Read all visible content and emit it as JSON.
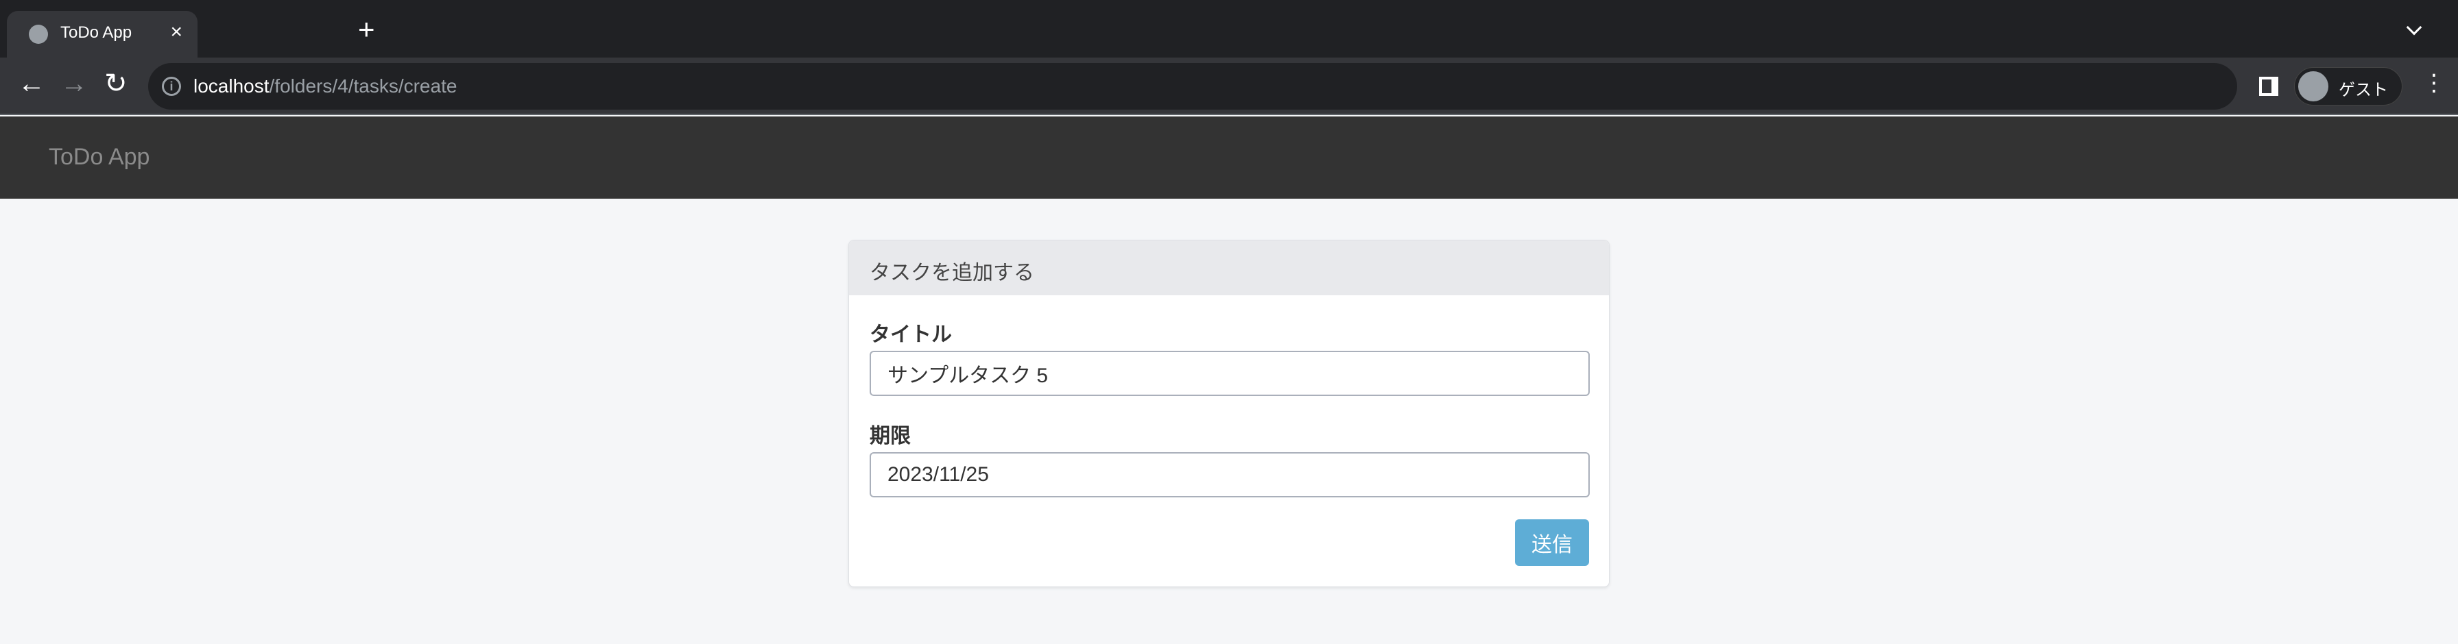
{
  "browser": {
    "tab_title": "ToDo App",
    "url_host": "localhost",
    "url_path": "/folders/4/tasks/create",
    "profile_name": "ゲスト",
    "icons": {
      "back": "←",
      "forward": "→",
      "reload": "↻",
      "new_tab": "+",
      "close": "×",
      "menu": "⋮",
      "info": "i"
    }
  },
  "navbar": {
    "brand": "ToDo App"
  },
  "card": {
    "heading": "タスクを追加する",
    "title_label": "タイトル",
    "title_value": "サンプルタスク 5",
    "due_label": "期限",
    "due_value": "2023/11/25",
    "submit_label": "送信",
    "submit_color": "#5eadd6"
  }
}
